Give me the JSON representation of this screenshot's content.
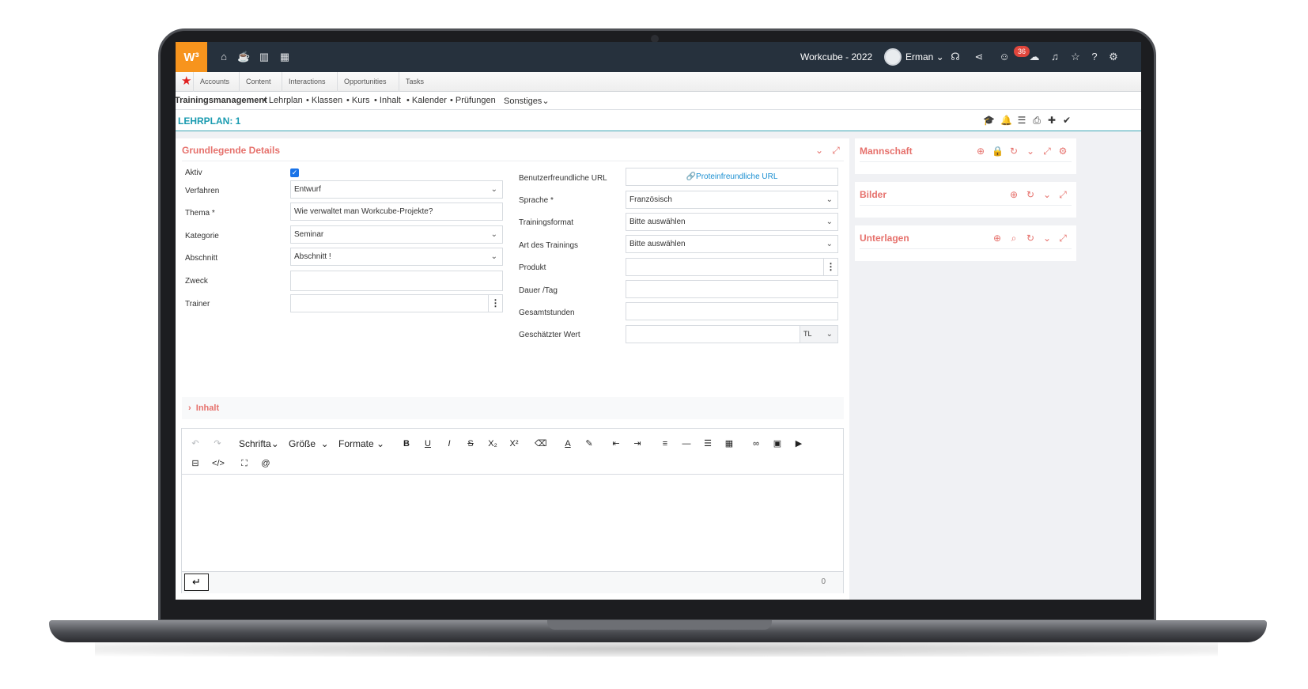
{
  "topbar": {
    "logo": "W³",
    "company": "Workcube - 2022",
    "user": "Erman",
    "notification_count": "36"
  },
  "tabs": [
    "Accounts",
    "Content",
    "Interactions",
    "Opportunities",
    "Tasks"
  ],
  "menu": {
    "module": "Trainingsmanagement",
    "items": [
      "Lehrplan",
      "Klassen",
      "Kurs",
      "Inhalt",
      "Kalender",
      "Prüfungen"
    ],
    "more": "Sonstiges"
  },
  "page": {
    "title": "LEHRPLAN: 1"
  },
  "details": {
    "title": "Grundlegende Details",
    "left": {
      "aktiv_label": "Aktiv",
      "verfahren_label": "Verfahren",
      "verfahren_value": "Entwurf",
      "thema_label": "Thema *",
      "thema_value": "Wie verwaltet man Workcube-Projekte?",
      "kategorie_label": "Kategorie",
      "kategorie_value": "Seminar",
      "abschnitt_label": "Abschnitt",
      "abschnitt_value": "Abschnitt !",
      "zweck_label": "Zweck",
      "trainer_label": "Trainer"
    },
    "right": {
      "url_label": "Benutzerfreundliche URL",
      "url_button": "Proteinfreundliche URL",
      "sprache_label": "Sprache *",
      "sprache_value": "Französisch",
      "format_label": "Trainingsformat",
      "format_value": "Bitte auswählen",
      "art_label": "Art des Trainings",
      "art_value": "Bitte auswählen",
      "produkt_label": "Produkt",
      "dauer_label": "Dauer /Tag",
      "stunden_label": "Gesamtstunden",
      "wert_label": "Geschätzter Wert",
      "currency": "TL"
    }
  },
  "inhalt": {
    "label": "Inhalt"
  },
  "editor": {
    "font_label": "Schrifta",
    "size_label": "Größe",
    "format_label": "Formate",
    "word_count": "0"
  },
  "side_panels": {
    "team": "Mannschaft",
    "images": "Bilder",
    "documents": "Unterlagen"
  },
  "colors": {
    "topbar": "#26313d",
    "logo": "#f7941d",
    "accent": "#e6716c",
    "title": "#1a9bb0",
    "link": "#1a8fd1"
  }
}
